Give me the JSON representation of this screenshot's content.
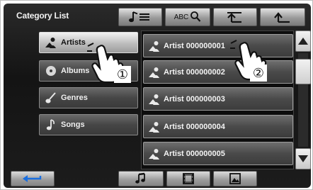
{
  "header": {
    "title": "Category List",
    "abc_label": "ABC"
  },
  "categories": [
    {
      "label": "Artists",
      "icon": "artist-icon",
      "selected": true
    },
    {
      "label": "Albums",
      "icon": "album-icon",
      "selected": false
    },
    {
      "label": "Genres",
      "icon": "genre-icon",
      "selected": false
    },
    {
      "label": "Songs",
      "icon": "song-icon",
      "selected": false
    }
  ],
  "list_items": [
    {
      "label": "Artist 000000001"
    },
    {
      "label": "Artist 000000002"
    },
    {
      "label": "Artist 000000003"
    },
    {
      "label": "Artist 000000004"
    },
    {
      "label": "Artist 000000005"
    }
  ],
  "callouts": {
    "step1": "①",
    "step2": "②"
  },
  "colors": {
    "panel_bg": "#1a1a1a",
    "button_silver": "#b8b8b8",
    "row_gray": "#4e4e4e"
  }
}
